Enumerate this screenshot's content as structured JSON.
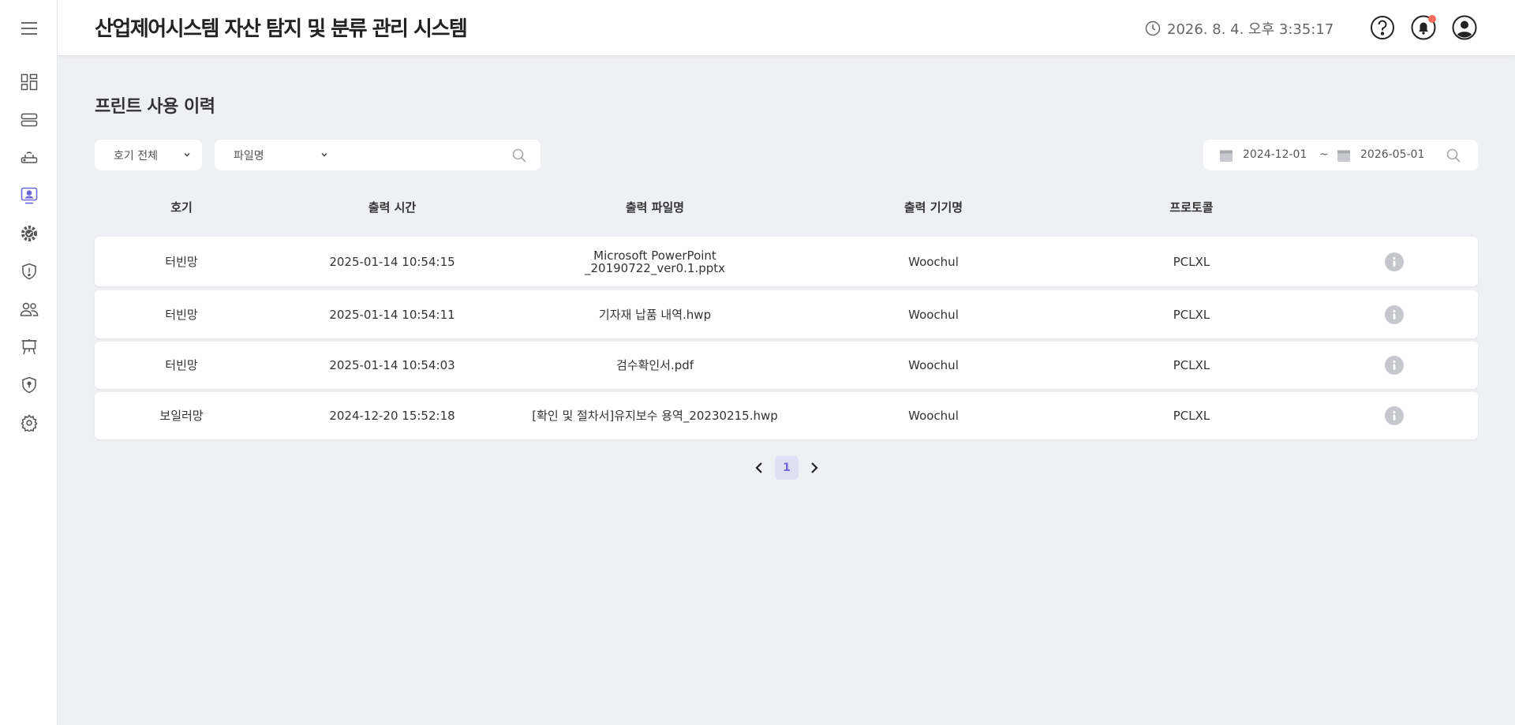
{
  "app": {
    "title": "산업제어시스템 자산 탐지 및 분류 관리 시스템",
    "clock": "2026. 8. 4. 오후 3:35:17"
  },
  "sidebar": {
    "items": [
      {
        "icon": "dashboard-icon"
      },
      {
        "icon": "server-icon"
      },
      {
        "icon": "router-icon"
      },
      {
        "icon": "monitor-user-icon",
        "active": true
      },
      {
        "icon": "gear-badge-icon"
      },
      {
        "icon": "shield-alert-icon"
      },
      {
        "icon": "users-icon"
      },
      {
        "icon": "easel-icon"
      },
      {
        "icon": "shield-icon"
      },
      {
        "icon": "settings-icon"
      }
    ]
  },
  "page": {
    "title": "프린트 사용 이력"
  },
  "filters": {
    "unit_select": "호기 전체",
    "search_type": "파일명",
    "search_value": "",
    "date_from": "2024-12-01",
    "date_sep": "~",
    "date_to": "2026-05-01"
  },
  "table": {
    "columns": [
      "호기",
      "출력 시간",
      "출력 파일명",
      "출력 기기명",
      "프로토콜"
    ],
    "rows": [
      {
        "unit": "터빈망",
        "time": "2025-01-14 10:54:15",
        "file_line1": "Microsoft PowerPoint",
        "file_line2": "_20190722_ver0.1.pptx",
        "device": "Woochul",
        "protocol": "PCLXL"
      },
      {
        "unit": "터빈망",
        "time": "2025-01-14 10:54:11",
        "file_line1": "기자재 납품 내역.hwp",
        "file_line2": "",
        "device": "Woochul",
        "protocol": "PCLXL"
      },
      {
        "unit": "터빈망",
        "time": "2025-01-14 10:54:03",
        "file_line1": "검수확인서.pdf",
        "file_line2": "",
        "device": "Woochul",
        "protocol": "PCLXL"
      },
      {
        "unit": "보일러망",
        "time": "2024-12-20 15:52:18",
        "file_line1": "[확인 및 절차서]유지보수 용역_20230215.hwp",
        "file_line2": "",
        "device": "Woochul",
        "protocol": "PCLXL"
      }
    ]
  },
  "pagination": {
    "current": "1"
  },
  "colors": {
    "accent": "#6d68d9",
    "badge": "#f26b5b",
    "background": "#eff0f4"
  }
}
